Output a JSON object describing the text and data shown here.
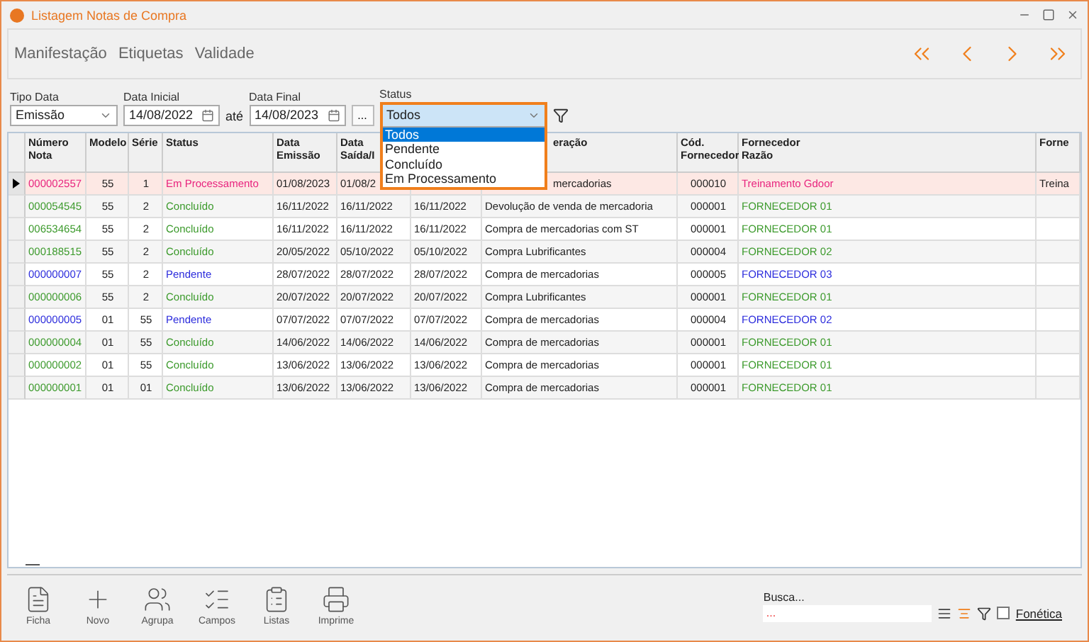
{
  "window": {
    "title": "Listagem Notas de Compra"
  },
  "menu": [
    "Manifestação",
    "Etiquetas",
    "Validade"
  ],
  "filters": {
    "tipo_data": {
      "label": "Tipo Data",
      "value": "Emissão"
    },
    "data_inicial": {
      "label": "Data Inicial",
      "value": "14/08/2022"
    },
    "ate": "até",
    "data_final": {
      "label": "Data Final",
      "value": "14/08/2023"
    },
    "more": "...",
    "status": {
      "label": "Status",
      "value": "Todos",
      "expanded": true,
      "options": [
        {
          "label": "Todos",
          "selected": true
        },
        {
          "label": "Pendente",
          "selected": false
        },
        {
          "label": "Concluído",
          "selected": false
        },
        {
          "label": "Em Processamento",
          "selected": false
        }
      ]
    }
  },
  "table": {
    "columns": [
      "Número Nota",
      "Modelo",
      "Série",
      "Status",
      "Data Emissão",
      "Data Saída/I",
      "",
      "eração",
      "Cód. Fornecedor",
      "Fornecedor Razão",
      "Forne"
    ],
    "rows": [
      {
        "selected": true,
        "kind": "processing",
        "cells": [
          "000002557",
          "55",
          "1",
          "Em Processamento",
          "01/08/2023",
          "01/08/2",
          "",
          "mercadorias",
          "000010",
          "Treinamento Gdoor",
          "Treina"
        ]
      },
      {
        "selected": false,
        "kind": "done",
        "cells": [
          "000054545",
          "55",
          "2",
          "Concluído",
          "16/11/2022",
          "16/11/2022",
          "16/11/2022",
          "Devolução de venda de mercadoria",
          "000001",
          "FORNECEDOR 01",
          ""
        ]
      },
      {
        "selected": false,
        "kind": "done",
        "cells": [
          "006534654",
          "55",
          "2",
          "Concluído",
          "16/11/2022",
          "16/11/2022",
          "16/11/2022",
          "Compra de mercadorias com ST",
          "000001",
          "FORNECEDOR 01",
          ""
        ]
      },
      {
        "selected": false,
        "kind": "done",
        "cells": [
          "000188515",
          "55",
          "2",
          "Concluído",
          "20/05/2022",
          "05/10/2022",
          "05/10/2022",
          "Compra Lubrificantes",
          "000004",
          "FORNECEDOR 02",
          ""
        ]
      },
      {
        "selected": false,
        "kind": "pending",
        "cells": [
          "000000007",
          "55",
          "2",
          "Pendente",
          "28/07/2022",
          "28/07/2022",
          "28/07/2022",
          "Compra de mercadorias",
          "000005",
          "FORNECEDOR 03",
          ""
        ]
      },
      {
        "selected": false,
        "kind": "done",
        "cells": [
          "000000006",
          "55",
          "2",
          "Concluído",
          "20/07/2022",
          "20/07/2022",
          "20/07/2022",
          "Compra Lubrificantes",
          "000001",
          "FORNECEDOR 01",
          ""
        ]
      },
      {
        "selected": false,
        "kind": "pending",
        "cells": [
          "000000005",
          "01",
          "55",
          "Pendente",
          "07/07/2022",
          "07/07/2022",
          "07/07/2022",
          "Compra de mercadorias",
          "000004",
          "FORNECEDOR 02",
          ""
        ]
      },
      {
        "selected": false,
        "kind": "done",
        "cells": [
          "000000004",
          "01",
          "55",
          "Concluído",
          "14/06/2022",
          "14/06/2022",
          "14/06/2022",
          "Compra de mercadorias",
          "000001",
          "FORNECEDOR 01",
          ""
        ]
      },
      {
        "selected": false,
        "kind": "done",
        "cells": [
          "000000002",
          "01",
          "55",
          "Concluído",
          "13/06/2022",
          "13/06/2022",
          "13/06/2022",
          "Compra de mercadorias",
          "000001",
          "FORNECEDOR 01",
          ""
        ]
      },
      {
        "selected": false,
        "kind": "done",
        "cells": [
          "000000001",
          "01",
          "01",
          "Concluído",
          "13/06/2022",
          "13/06/2022",
          "13/06/2022",
          "Compra de mercadorias",
          "000001",
          "FORNECEDOR 01",
          ""
        ]
      }
    ]
  },
  "toolbar": [
    {
      "kind": "ficha",
      "label": "Ficha"
    },
    {
      "kind": "novo",
      "label": "Novo"
    },
    {
      "kind": "agrupa",
      "label": "Agrupa"
    },
    {
      "kind": "campos",
      "label": "Campos"
    },
    {
      "kind": "listas",
      "label": "Listas"
    },
    {
      "kind": "imprime",
      "label": "Imprime"
    }
  ],
  "search": {
    "label": "Busca...",
    "hint": "...",
    "fonetica": {
      "label": "Fonética",
      "checked": false
    }
  }
}
